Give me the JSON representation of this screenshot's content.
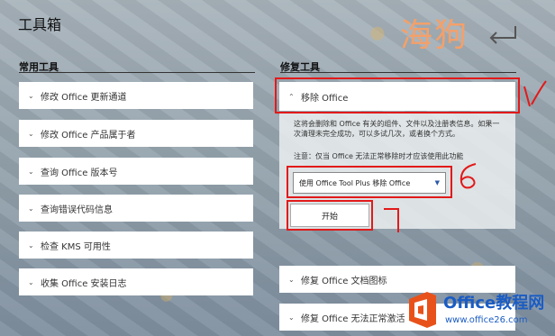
{
  "page": {
    "title": "工具箱"
  },
  "watermark": {
    "text": "海狗"
  },
  "left_column": {
    "title": "常用工具",
    "items": [
      {
        "label": "修改 Office 更新通道"
      },
      {
        "label": "修改 Office 产品属于者"
      },
      {
        "label": "查询 Office 版本号"
      },
      {
        "label": "查询错误代码信息"
      },
      {
        "label": "检查 KMS 可用性"
      },
      {
        "label": "收集 Office 安装日志"
      }
    ]
  },
  "right_column": {
    "title": "修复工具",
    "expanded": {
      "label": "移除 Office",
      "description": "这将会删除和 Office 有关的组件、文件以及注册表信息。如果一次清理未完全成功，可以多试几次，或者换个方式。",
      "note": "注意：仅当 Office 无法正常移除时才应该使用此功能",
      "select_value": "使用 Office Tool Plus 移除 Office",
      "start_label": "开始"
    },
    "items": [
      {
        "label": "修复 Office 文档图标"
      },
      {
        "label": "修复 Office 无法正常激活"
      }
    ]
  },
  "logo": {
    "main": "Office教程网",
    "sub": "www.office26.com"
  },
  "colors": {
    "annotation": "#e21a1a",
    "accent": "#1a5cc4",
    "watermark": "#f4a06a"
  }
}
